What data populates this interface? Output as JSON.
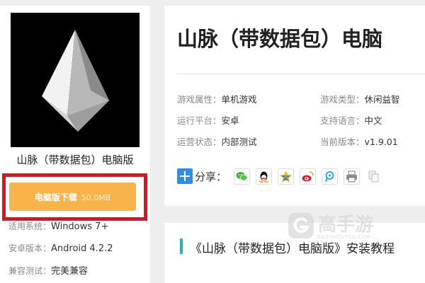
{
  "app": {
    "name": "山脉（带数据包）电脑版",
    "title": "山脉（带数据包）电脑",
    "download": {
      "label": "电脑版下载",
      "size": "50.0MB"
    }
  },
  "specs": [
    {
      "label": "适用系统：",
      "value": "Windows 7+"
    },
    {
      "label": "安卓版本：",
      "value": "Android 4.2.2"
    },
    {
      "label": "兼容测试：",
      "value": "完美兼容"
    }
  ],
  "attributes": [
    {
      "label": "游戏属性：",
      "value": "单机游戏"
    },
    {
      "label": "游戏类型：",
      "value": "休闲益智"
    },
    {
      "label": "运行平台：",
      "value": "安卓"
    },
    {
      "label": "支持语言：",
      "value": "中文"
    },
    {
      "label": "运营状态：",
      "value": "内部测试"
    },
    {
      "label": "当前版本：",
      "value": "v1.9.01"
    }
  ],
  "share": {
    "label": "分享：",
    "icons": [
      "wechat-icon",
      "qq-icon",
      "qzone-icon",
      "weibo-icon",
      "tencent-weibo-icon",
      "print-icon",
      "copy-icon"
    ]
  },
  "section": {
    "heading": "《山脉（带数据包）电脑版》安装教程"
  },
  "watermark": {
    "name": "高手游",
    "domain": "GAOSHOUYOU.COM"
  },
  "colors": {
    "accent": "#f7b44a",
    "highlight": "#e1121b",
    "share_blue": "#2f8de4",
    "section_bar": "#2ab0c0"
  }
}
